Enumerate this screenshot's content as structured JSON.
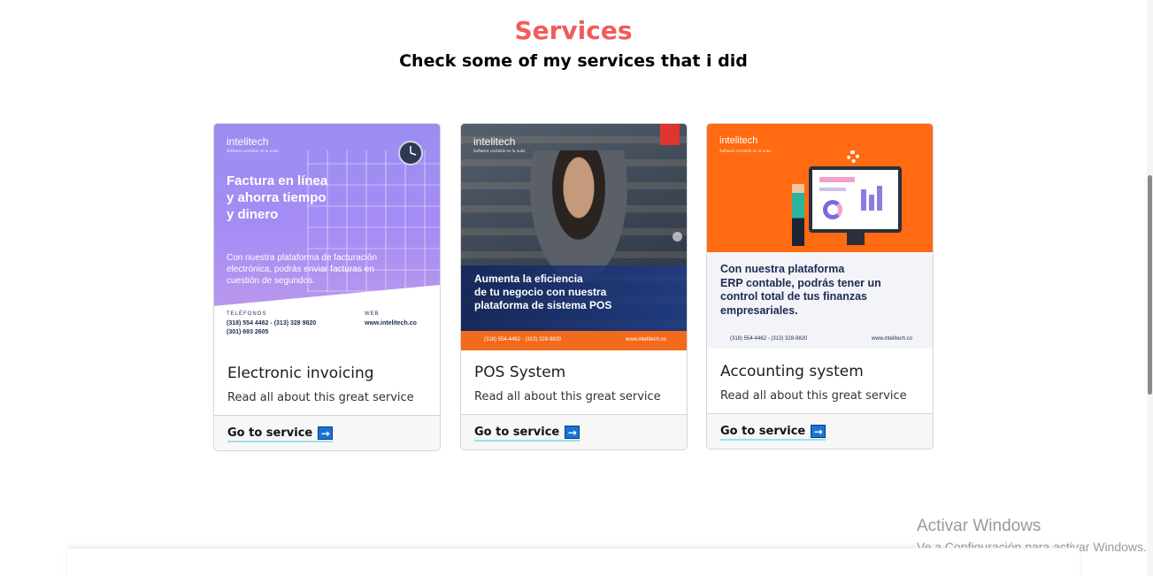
{
  "section": {
    "title": "Services",
    "subtitle": "Check some of my services that i did"
  },
  "cards": [
    {
      "poster": {
        "brand": "intelitech",
        "brand_sub": "Software contable en la nube",
        "headline_lines": [
          "Factura en línea",
          "y ahorra tiempo",
          "y dinero"
        ],
        "body": "Con nuestra plataforma de facturación electrónica, podrás enviar facturas en cuestión de segundos.",
        "phones_label": "TELÉFONOS",
        "phones": "(318) 554 4462 - (313) 328 9820",
        "phones2": "(301) 693 2605",
        "web_label": "WEB",
        "web": "www.intelitech.co"
      },
      "title": "Electronic invoicing",
      "text": "Read all about this great service",
      "link": "Go to service",
      "arrow": "→"
    },
    {
      "poster": {
        "brand": "intelitech",
        "brand_sub": "Software contable en la nube",
        "headline_lines": [
          "Aumenta la eficiencia",
          "de tu negocio con nuestra",
          "plataforma de sistema POS"
        ],
        "phones": "(318) 554-4462 - (313) 328-9820",
        "web": "www.intelitech.co"
      },
      "title": "POS System",
      "text": "Read all about this great service",
      "link": "Go to service",
      "arrow": "→"
    },
    {
      "poster": {
        "brand": "intelitech",
        "brand_sub": "Software contable en la nube",
        "headline_lines": [
          "Con nuestra plataforma",
          "ERP contable, podrás tener un",
          "control total de tus finanzas",
          "empresariales."
        ],
        "phones": "(318) 554-4462 - (313) 328-9820",
        "web": "www.intelitech.co"
      },
      "title": "Accounting system",
      "text": "Read all about this great service",
      "link": "Go to service",
      "arrow": "→"
    }
  ],
  "watermark": {
    "title": "Activar Windows",
    "sub": "Ve a Configuración para activar Windows."
  },
  "colors": {
    "title": "#f25c5c",
    "orange": "#ff6a13",
    "link_underline": "#9be0e6",
    "arrow_bg": "#1a73d9"
  }
}
